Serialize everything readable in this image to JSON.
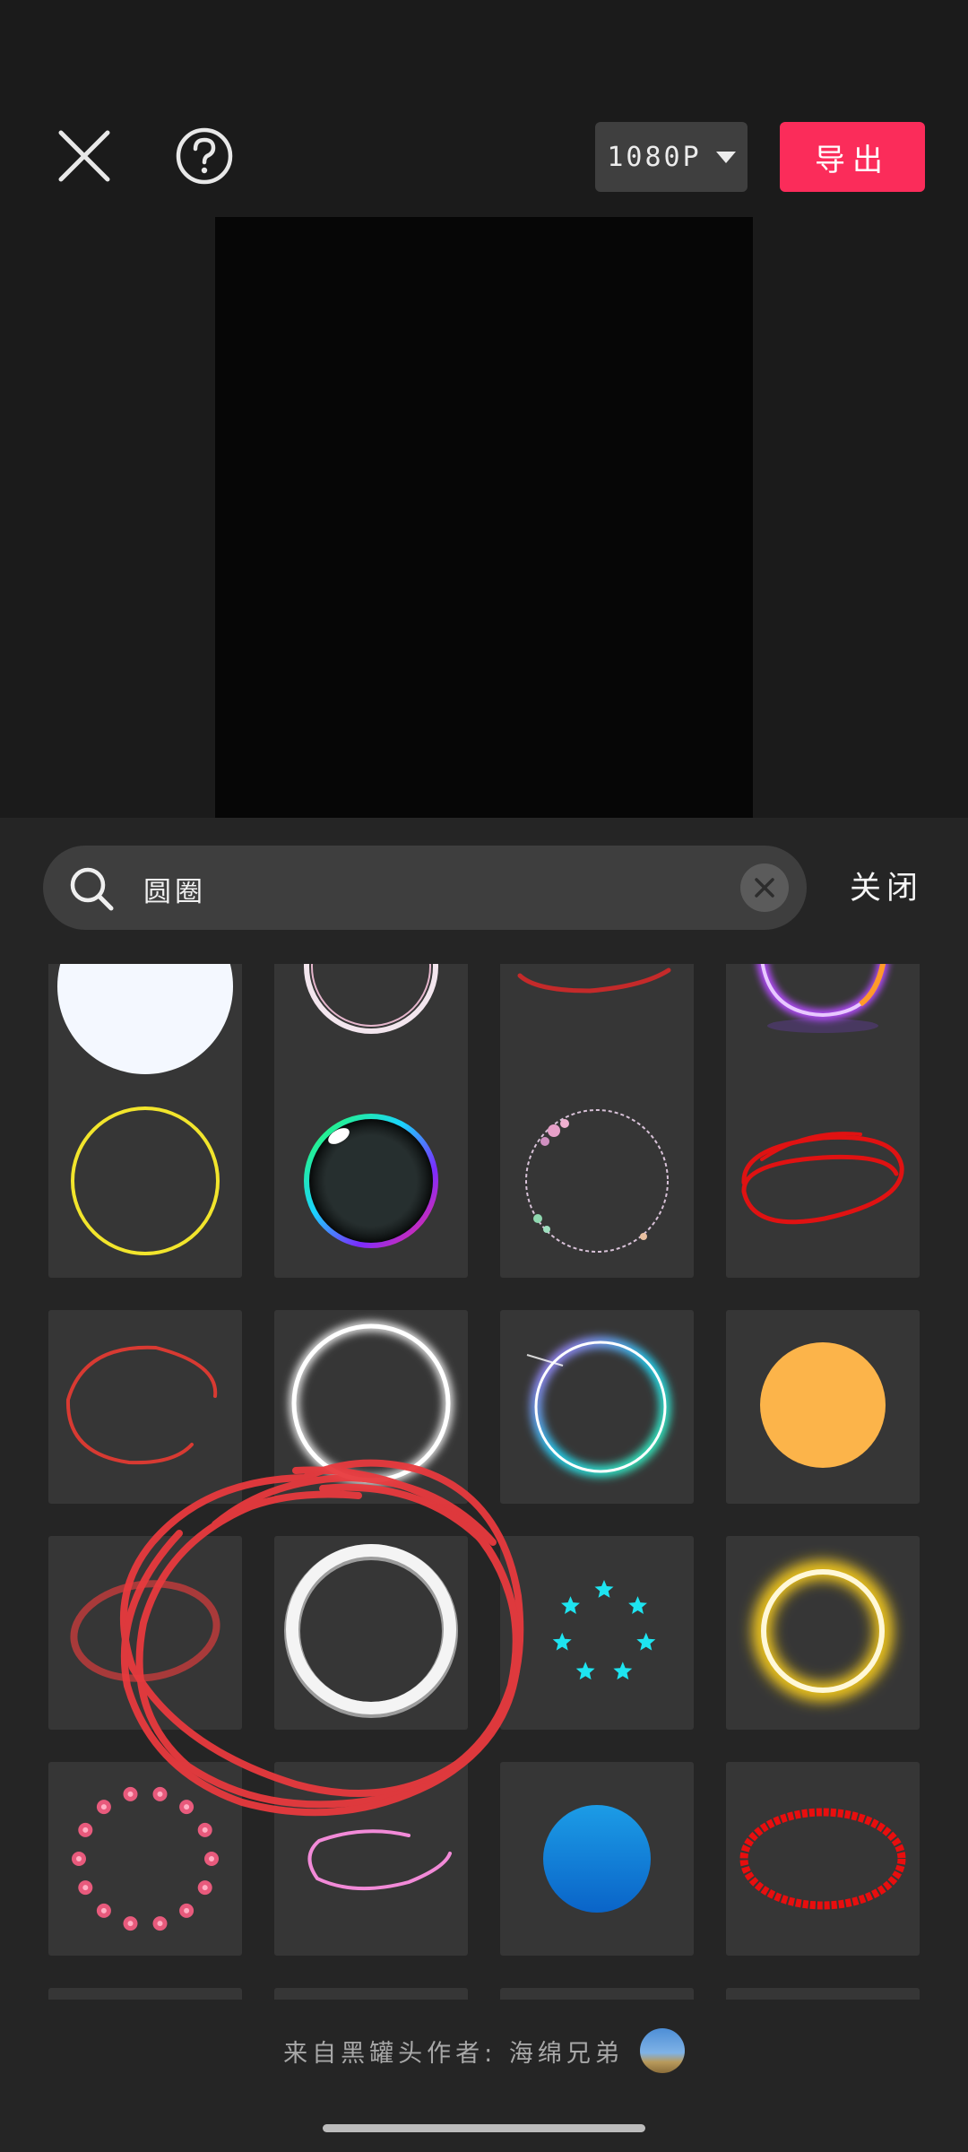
{
  "toolbar": {
    "resolution_label": "1080P",
    "export_label": "导出"
  },
  "search": {
    "query": "圆圈",
    "close_label": "关闭"
  },
  "grid": {
    "items": [
      {
        "name": "white-disc"
      },
      {
        "name": "pink-ring"
      },
      {
        "name": "red-stroke"
      },
      {
        "name": "purple-neon-ring"
      },
      {
        "name": "yellow-thin-ring"
      },
      {
        "name": "rainbow-bubble"
      },
      {
        "name": "floral-ring"
      },
      {
        "name": "red-scribble-ellipse"
      },
      {
        "name": "red-hand-drawn-circle"
      },
      {
        "name": "white-glow-ring"
      },
      {
        "name": "rainbow-glow-ring"
      },
      {
        "name": "orange-disc"
      },
      {
        "name": "red-ellipse"
      },
      {
        "name": "white-3d-ring"
      },
      {
        "name": "cyan-star-ring"
      },
      {
        "name": "golden-glow-ring"
      },
      {
        "name": "pink-rose-ring"
      },
      {
        "name": "pink-scribble"
      },
      {
        "name": "blue-disc"
      },
      {
        "name": "red-pixel-ellipse"
      }
    ]
  },
  "footer": {
    "credit": "来自黑罐头作者: 海绵兄弟"
  },
  "colors": {
    "accent": "#fb2c5a",
    "panel": "#252525",
    "tile": "#363636",
    "annotation": "#e83a3e"
  }
}
